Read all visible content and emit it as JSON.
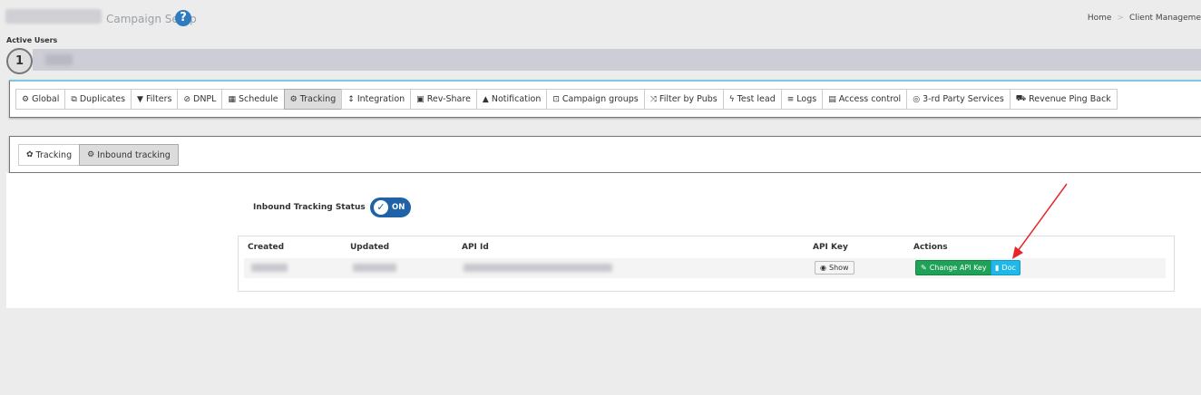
{
  "header": {
    "campaign_title": "Campaign Setup",
    "help_icon": "question-circle-icon",
    "breadcrumb": [
      "Home",
      "Client Manageme"
    ]
  },
  "active_users": {
    "label": "Active Users",
    "step_number": "1"
  },
  "main_tabs": [
    {
      "label": "Global",
      "icon": "cogs-icon",
      "glyph": "⚙",
      "active": false
    },
    {
      "label": "Duplicates",
      "icon": "copy-icon",
      "glyph": "⧉",
      "active": false
    },
    {
      "label": "Filters",
      "icon": "filter-icon",
      "glyph": "▼",
      "active": false
    },
    {
      "label": "DNPL",
      "icon": "ban-icon",
      "glyph": "⊘",
      "active": false
    },
    {
      "label": "Schedule",
      "icon": "calendar-icon",
      "glyph": "▦",
      "active": false
    },
    {
      "label": "Tracking",
      "icon": "cogs-icon",
      "glyph": "⚙",
      "active": true
    },
    {
      "label": "Integration",
      "icon": "arrows-vertical-icon",
      "glyph": "↕",
      "active": false
    },
    {
      "label": "Rev-Share",
      "icon": "money-icon",
      "glyph": "▣",
      "active": false
    },
    {
      "label": "Notification",
      "icon": "bell-icon",
      "glyph": "▲",
      "active": false
    },
    {
      "label": "Campaign groups",
      "icon": "object-group-icon",
      "glyph": "⊡",
      "active": false
    },
    {
      "label": "Filter by Pubs",
      "icon": "random-icon",
      "glyph": "⤨",
      "active": false
    },
    {
      "label": "Test lead",
      "icon": "bolt-icon",
      "glyph": "ϟ",
      "active": false
    },
    {
      "label": "Logs",
      "icon": "list-icon",
      "glyph": "≡",
      "active": false
    },
    {
      "label": "Access control",
      "icon": "file-lock-icon",
      "glyph": "▤",
      "active": false
    },
    {
      "label": "3-rd Party Services",
      "icon": "handshake-icon",
      "glyph": "◎",
      "active": false
    },
    {
      "label": "Revenue Ping Back",
      "icon": "cart-icon",
      "glyph": "⛟",
      "active": false
    }
  ],
  "sub_tabs": [
    {
      "label": "Tracking",
      "icon": "cog-icon",
      "glyph": "✿",
      "active": false
    },
    {
      "label": "Inbound tracking",
      "icon": "cogs-icon",
      "glyph": "⚙",
      "active": true
    }
  ],
  "inbound": {
    "status_label": "Inbound Tracking Status",
    "toggle_text": "ON",
    "toggle_state": "on"
  },
  "table": {
    "headers": [
      "Created",
      "Updated",
      "API Id",
      "API Key",
      "Actions"
    ],
    "show_label": "Show",
    "change_key_label": "Change API Key",
    "doc_label": "Doc"
  },
  "colors": {
    "toggle": "#1f62a5",
    "change_button": "#1fa257",
    "doc_button": "#20b8e8",
    "annotation_arrow": "#e8262a"
  }
}
